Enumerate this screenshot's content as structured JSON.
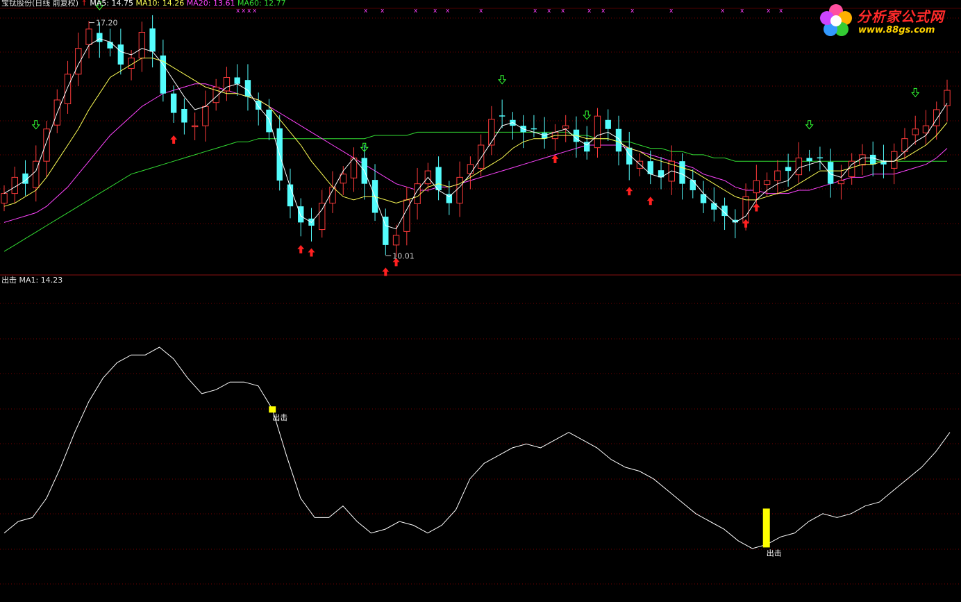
{
  "header": {
    "stock_name": "宝钛股份(日线 前复权)",
    "ma5": "MA5: 14.75",
    "ma10": "MA10: 14.26",
    "ma20": "MA20: 13.61",
    "ma60": "MA60: 12.77"
  },
  "indicator_header": {
    "name": "出击",
    "ma1": "MA1: 14.23"
  },
  "logo": {
    "main": "分析家公式网",
    "sub": "www.88gs.com"
  },
  "colors": {
    "background": "#000000",
    "up_candle": "#ff3b3b",
    "down_candle": "#54fcfc",
    "ma5": "#ffffff",
    "ma10": "#ffff55",
    "ma20": "#ff44ff",
    "ma60": "#33dd33",
    "indicator": "#ffffff",
    "signal": "#ffff00",
    "grid": "#7a0000",
    "buy_arrow": "#ff2020",
    "sell_arrow": "#33ff33",
    "x_marker": "#ff40ff"
  },
  "chart_data": [
    {
      "type": "candlestick",
      "annotations": [
        {
          "label": "17.20",
          "value": 17.2
        },
        {
          "label": "10.01",
          "value": 10.01
        }
      ],
      "ylim": [
        9.5,
        17.6
      ],
      "grid": true,
      "series": [
        {
          "name": "MA5",
          "values": [
            11.9,
            12.1,
            12.3,
            12.6,
            13.5,
            14.4,
            15.2,
            15.9,
            16.5,
            16.7,
            16.6,
            16.3,
            16.2,
            16.4,
            16.3,
            15.9,
            15.4,
            14.9,
            14.5,
            14.6,
            14.9,
            15.2,
            15.3,
            15.1,
            14.6,
            14.2,
            13.1,
            12.1,
            11.2,
            11.0,
            11.4,
            12.0,
            12.6,
            13.0,
            12.6,
            11.8,
            10.9,
            10.8,
            11.4,
            12.0,
            12.4,
            12.0,
            11.8,
            12.1,
            12.5,
            13.0,
            13.5,
            14.0,
            14.1,
            13.9,
            13.8,
            13.7,
            13.8,
            13.9,
            13.6,
            13.4,
            13.7,
            13.8,
            13.6,
            13.1,
            12.8,
            12.5,
            12.4,
            12.6,
            12.5,
            12.3,
            11.9,
            11.6,
            11.3,
            11.0,
            11.2,
            11.7,
            12.0,
            12.2,
            12.3,
            12.7,
            12.8,
            12.9,
            12.5,
            12.4,
            12.8,
            13.0,
            13.0,
            12.9,
            12.9,
            13.2,
            13.5,
            13.7,
            14.2,
            14.7
          ]
        },
        {
          "name": "MA10",
          "values": [
            11.5,
            11.6,
            11.8,
            12.0,
            12.4,
            12.9,
            13.4,
            13.9,
            14.5,
            15.0,
            15.5,
            15.7,
            15.9,
            16.1,
            16.1,
            16.0,
            15.8,
            15.6,
            15.4,
            15.2,
            15.1,
            15.0,
            15.0,
            14.9,
            14.8,
            14.6,
            14.2,
            13.8,
            13.4,
            12.9,
            12.5,
            12.1,
            11.8,
            11.7,
            11.8,
            11.8,
            11.7,
            11.6,
            11.7,
            11.8,
            12.1,
            12.2,
            12.1,
            12.2,
            12.4,
            12.6,
            12.8,
            13.0,
            13.3,
            13.5,
            13.6,
            13.6,
            13.7,
            13.7,
            13.7,
            13.6,
            13.6,
            13.6,
            13.5,
            13.3,
            13.2,
            13.0,
            12.9,
            12.8,
            12.7,
            12.6,
            12.4,
            12.2,
            12.0,
            11.8,
            11.7,
            11.7,
            11.8,
            11.9,
            12.0,
            12.2,
            12.4,
            12.6,
            12.6,
            12.6,
            12.7,
            12.8,
            12.8,
            12.9,
            12.9,
            13.0,
            13.2,
            13.4,
            13.7,
            14.1
          ]
        },
        {
          "name": "MA20",
          "values": [
            11.0,
            11.1,
            11.2,
            11.3,
            11.5,
            11.8,
            12.1,
            12.5,
            12.9,
            13.3,
            13.7,
            14.0,
            14.3,
            14.6,
            14.8,
            15.0,
            15.1,
            15.2,
            15.3,
            15.3,
            15.2,
            15.1,
            15.0,
            14.9,
            14.8,
            14.6,
            14.4,
            14.2,
            14.0,
            13.8,
            13.6,
            13.4,
            13.2,
            13.0,
            12.8,
            12.6,
            12.4,
            12.2,
            12.1,
            12.0,
            12.0,
            12.1,
            12.1,
            12.2,
            12.3,
            12.4,
            12.5,
            12.6,
            12.7,
            12.8,
            12.9,
            13.0,
            13.1,
            13.2,
            13.3,
            13.4,
            13.4,
            13.4,
            13.4,
            13.3,
            13.2,
            13.1,
            13.0,
            12.9,
            12.8,
            12.7,
            12.5,
            12.4,
            12.3,
            12.1,
            12.0,
            12.0,
            11.9,
            11.9,
            11.9,
            12.0,
            12.0,
            12.1,
            12.2,
            12.3,
            12.4,
            12.4,
            12.5,
            12.5,
            12.5,
            12.6,
            12.7,
            12.8,
            13.0,
            13.3
          ]
        },
        {
          "name": "MA60",
          "values": [
            10.1,
            10.3,
            10.5,
            10.7,
            10.9,
            11.1,
            11.3,
            11.5,
            11.7,
            11.9,
            12.1,
            12.3,
            12.5,
            12.6,
            12.7,
            12.8,
            12.9,
            13.0,
            13.1,
            13.2,
            13.3,
            13.4,
            13.5,
            13.5,
            13.6,
            13.6,
            13.6,
            13.6,
            13.6,
            13.6,
            13.6,
            13.6,
            13.6,
            13.6,
            13.6,
            13.7,
            13.7,
            13.7,
            13.7,
            13.8,
            13.8,
            13.8,
            13.8,
            13.8,
            13.8,
            13.8,
            13.8,
            13.8,
            13.8,
            13.8,
            13.8,
            13.8,
            13.8,
            13.8,
            13.7,
            13.7,
            13.6,
            13.6,
            13.5,
            13.5,
            13.4,
            13.3,
            13.3,
            13.2,
            13.2,
            13.1,
            13.1,
            13.0,
            13.0,
            12.9,
            12.9,
            12.9,
            12.9,
            12.9,
            12.9,
            12.9,
            12.9,
            12.9,
            12.9,
            12.9,
            12.9,
            12.9,
            12.9,
            12.9,
            12.9,
            12.9,
            12.9,
            12.9,
            12.9,
            12.9
          ]
        }
      ],
      "closes": [
        11.9,
        12.4,
        12.2,
        12.9,
        13.9,
        14.8,
        15.6,
        16.4,
        17.0,
        16.6,
        16.4,
        15.9,
        16.1,
        16.9,
        16.3,
        15.0,
        14.4,
        14.1,
        14.0,
        14.6,
        15.2,
        15.5,
        15.3,
        14.9,
        14.5,
        13.8,
        12.3,
        11.5,
        11.0,
        10.9,
        11.6,
        12.1,
        12.5,
        13.0,
        12.2,
        11.3,
        10.3,
        10.6,
        11.7,
        12.2,
        12.6,
        12.0,
        11.6,
        12.4,
        12.8,
        13.4,
        14.2,
        14.3,
        14.0,
        13.8,
        13.9,
        13.6,
        13.8,
        14.0,
        13.5,
        13.2,
        14.3,
        13.9,
        13.2,
        12.8,
        12.9,
        12.5,
        12.4,
        12.9,
        12.2,
        12.0,
        11.6,
        11.4,
        11.2,
        11.0,
        11.8,
        12.3,
        12.3,
        12.6,
        12.6,
        13.0,
        12.9,
        13.0,
        12.2,
        12.3,
        12.9,
        13.1,
        12.8,
        12.8,
        13.2,
        13.6,
        13.9,
        14.0,
        14.5,
        15.1
      ],
      "buy_signals": [
        16,
        28,
        29,
        36,
        37,
        52,
        59,
        61,
        70,
        71
      ],
      "sell_signals": [
        3,
        9,
        34,
        47,
        55,
        76,
        86
      ]
    },
    {
      "type": "line",
      "series": [
        {
          "name": "MA1",
          "values": [
            11.2,
            11.5,
            11.6,
            12.1,
            12.9,
            13.8,
            14.6,
            15.2,
            15.6,
            15.8,
            15.8,
            16.0,
            15.7,
            15.2,
            14.8,
            14.9,
            15.1,
            15.1,
            15.0,
            14.4,
            13.2,
            12.1,
            11.6,
            11.6,
            11.9,
            11.5,
            11.2,
            11.3,
            11.5,
            11.4,
            11.2,
            11.4,
            11.8,
            12.6,
            13.0,
            13.2,
            13.4,
            13.5,
            13.4,
            13.6,
            13.8,
            13.6,
            13.4,
            13.1,
            12.9,
            12.8,
            12.6,
            12.3,
            12.0,
            11.7,
            11.5,
            11.3,
            11.0,
            10.8,
            10.9,
            11.1,
            11.2,
            11.5,
            11.7,
            11.6,
            11.7,
            11.9,
            12.0,
            12.3,
            12.6,
            12.9,
            13.3,
            13.8
          ]
        }
      ],
      "signals": [
        {
          "label": "出击",
          "index": 19
        },
        {
          "label": "出击",
          "index": 54
        }
      ]
    }
  ]
}
